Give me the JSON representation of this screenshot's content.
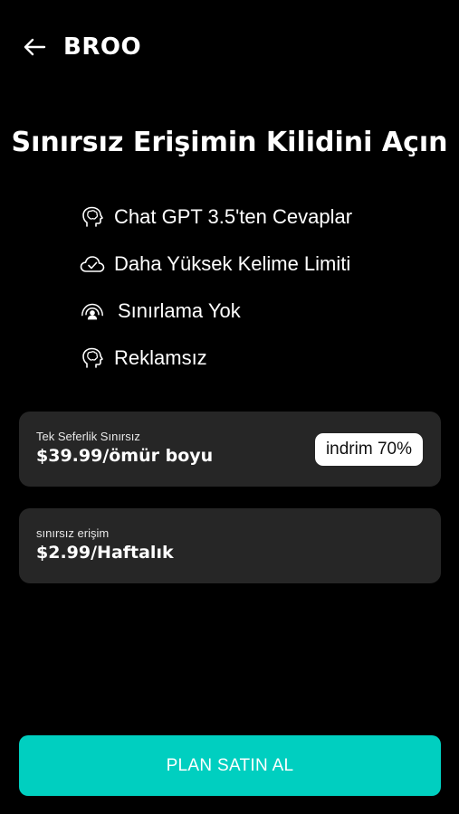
{
  "header": {
    "back_icon": "arrow-left-icon",
    "brand": "BROO"
  },
  "title": "Sınırsız Erişimin Kilidini Açın",
  "features": [
    {
      "icon": "brain-head-icon",
      "label": "Chat GPT 3.5'ten Cevaplar"
    },
    {
      "icon": "cloud-check-icon",
      "label": "Daha Yüksek Kelime Limiti"
    },
    {
      "icon": "user-signal-icon",
      "label": "Sınırlama Yok"
    },
    {
      "icon": "brain-head-icon",
      "label": "Reklamsız"
    }
  ],
  "plans": [
    {
      "label": "Tek Seferlik Sınırsız",
      "price": "$39.99/ömür boyu",
      "badge": "indrim 70%"
    },
    {
      "label": "sınırsız erişim",
      "price": "$2.99/Haftalık"
    }
  ],
  "cta": {
    "label": "PLAN SATIN AL"
  },
  "colors": {
    "background": "#000000",
    "card": "#262626",
    "accent": "#00cfc0",
    "text": "#ffffff"
  }
}
